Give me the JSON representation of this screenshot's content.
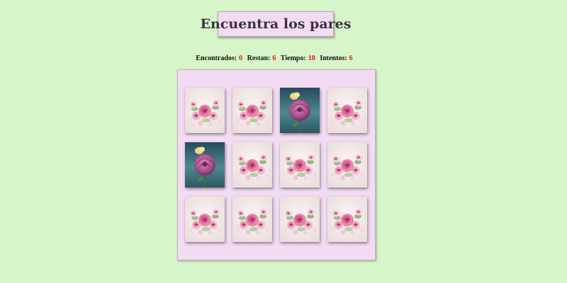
{
  "title": "Encuentra los pares",
  "stats": {
    "found_label": "Encontrados:",
    "found_value": "0",
    "remaining_label": "Restan:",
    "remaining_value": "6",
    "time_label": "Tiempo:",
    "time_value": "18",
    "attempts_label": "Intentos:",
    "attempts_value": "6"
  },
  "colors": {
    "background": "#d6f5c9",
    "panel": "#f3dcf3",
    "stat_number": "#e01b1b"
  },
  "board": {
    "rows": 3,
    "cols": 4,
    "cards": [
      {
        "state": "hidden",
        "image": "pink-roses-bouquet-icon"
      },
      {
        "state": "hidden",
        "image": "pink-roses-bouquet-icon"
      },
      {
        "state": "revealed",
        "image": "single-rose-icon"
      },
      {
        "state": "hidden",
        "image": "pink-roses-bouquet-icon"
      },
      {
        "state": "revealed",
        "image": "single-rose-icon"
      },
      {
        "state": "hidden",
        "image": "pink-roses-bouquet-icon"
      },
      {
        "state": "hidden",
        "image": "pink-roses-bouquet-icon"
      },
      {
        "state": "hidden",
        "image": "pink-roses-bouquet-icon"
      },
      {
        "state": "hidden",
        "image": "pink-roses-bouquet-icon"
      },
      {
        "state": "hidden",
        "image": "pink-roses-bouquet-icon"
      },
      {
        "state": "hidden",
        "image": "pink-roses-bouquet-icon"
      },
      {
        "state": "hidden",
        "image": "pink-roses-bouquet-icon"
      }
    ]
  }
}
